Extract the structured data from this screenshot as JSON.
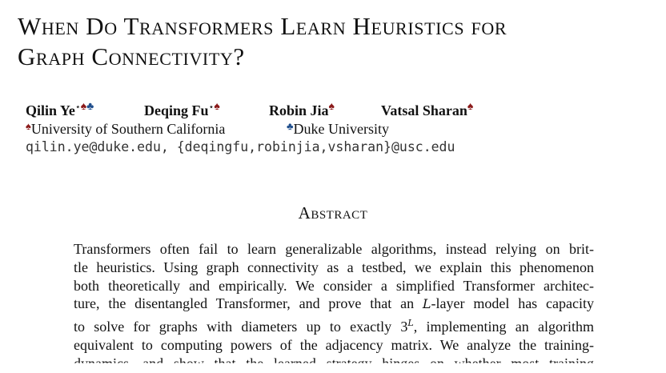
{
  "title_line1": "When Do Transformers Learn Heuristics for",
  "title_line2": "Graph Connectivity?",
  "authors": [
    {
      "name": "Qilin Ye",
      "marks": "⋆♠♣"
    },
    {
      "name": "Deqing Fu",
      "marks": "⋆♠"
    },
    {
      "name": "Robin Jia",
      "marks": "♠"
    },
    {
      "name": "Vatsal Sharan",
      "marks": "♠"
    }
  ],
  "affiliations": [
    {
      "mark": "♠",
      "name": "University of Southern California"
    },
    {
      "mark": "♣",
      "name": "Duke University"
    }
  ],
  "emails": "qilin.ye@duke.edu, {deqingfu,robinjia,vsharan}@usc.edu",
  "abstract_heading": "Abstract",
  "abstract_lines": [
    "Transformers often fail to learn generalizable algorithms, instead relying on brit-",
    "tle heuristics. Using graph connectivity as a testbed, we explain this phenomenon",
    "both theoretically and empirically. We consider a simplified Transformer architec-",
    "ture, the disentangled Transformer, and prove that an",
    "-layer model has capacity",
    "to solve for graphs with diameters up to exactly",
    ", implementing an algorithm",
    "equivalent to computing powers of the adjacency matrix. We analyze the training-",
    "dynamics, and show that the learned strategy hinges on whether most training"
  ],
  "math": {
    "L": "L",
    "power": "3",
    "exp": "L"
  }
}
